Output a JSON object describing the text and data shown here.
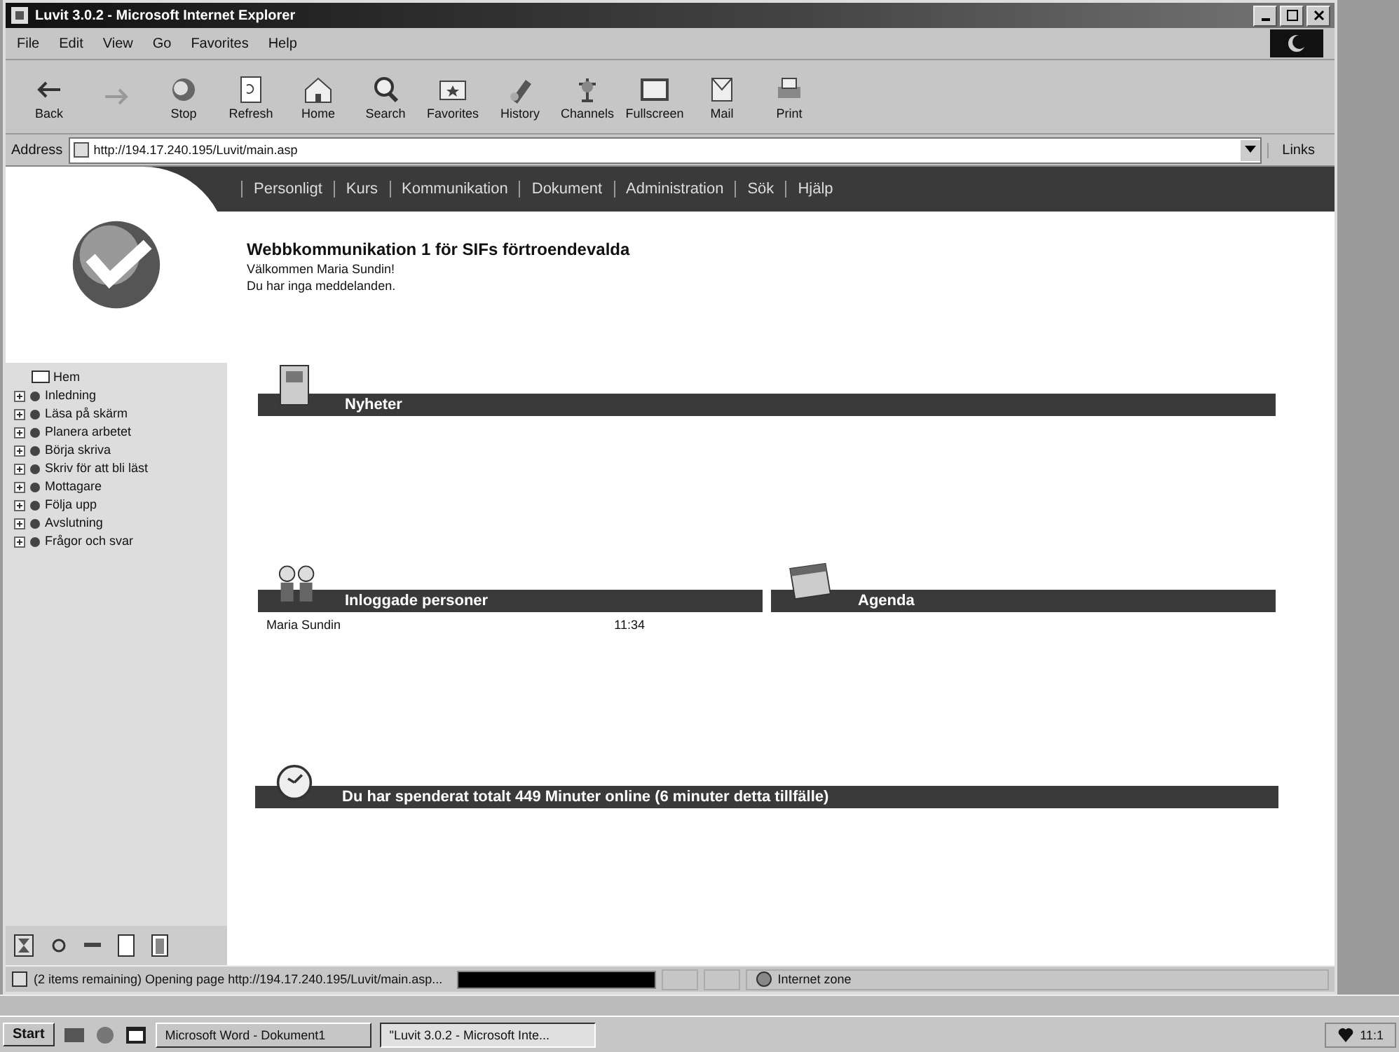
{
  "window": {
    "title": "Luvit 3.0.2 - Microsoft Internet Explorer"
  },
  "menu": [
    "File",
    "Edit",
    "View",
    "Go",
    "Favorites",
    "Help"
  ],
  "toolbar": [
    {
      "kind": "back",
      "label": "Back"
    },
    {
      "kind": "forward"
    },
    {
      "kind": "stop",
      "label": "Stop"
    },
    {
      "kind": "refresh",
      "label": "Refresh"
    },
    {
      "kind": "home",
      "label": "Home"
    },
    {
      "kind": "search",
      "label": "Search"
    },
    {
      "kind": "favorites",
      "label": "Favorites"
    },
    {
      "kind": "history",
      "label": "History"
    },
    {
      "kind": "channels",
      "label": "Channels"
    },
    {
      "kind": "fullscreen",
      "label": "Fullscreen"
    },
    {
      "kind": "mail",
      "label": "Mail"
    },
    {
      "kind": "print",
      "label": "Print"
    }
  ],
  "address": {
    "label": "Address",
    "value": "http://194.17.240.195/Luvit/main.asp",
    "links": "Links"
  },
  "nav": [
    "Personligt",
    "Kurs",
    "Kommunikation",
    "Dokument",
    "Administration",
    "Sök",
    "Hjälp"
  ],
  "heading": "Webbkommunikation 1 för SIFs förtroendevalda",
  "welcome": "Välkommen Maria Sundin!",
  "messages": "Du har inga meddelanden.",
  "tree": {
    "root": "Hem",
    "items": [
      "Inledning",
      "Läsa på skärm",
      "Planera arbetet",
      "Börja skriva",
      "Skriv för att bli läst",
      "Mottagare",
      "Följa upp",
      "Avslutning",
      "Frågor och svar"
    ]
  },
  "sections": {
    "news": "Nyheter",
    "online": "Inloggade personer",
    "agenda": "Agenda",
    "time_spent": "Du har spenderat totalt 449 Minuter online (6 minuter detta tillfälle)"
  },
  "online_users": [
    {
      "name": "Maria Sundin",
      "time": "11:34"
    }
  ],
  "status_bar": {
    "text": "(2 items remaining) Opening page http://194.17.240.195/Luvit/main.asp...",
    "level": 1,
    "zone": "Internet zone"
  },
  "taskbar": {
    "start": "Start",
    "tasks": [
      {
        "label": "Microsoft Word - Dokument1",
        "selected": false
      },
      {
        "label": "\"Luvit 3.0.2 - Microsoft Inte...",
        "selected": true
      }
    ],
    "clock": "11:1"
  }
}
